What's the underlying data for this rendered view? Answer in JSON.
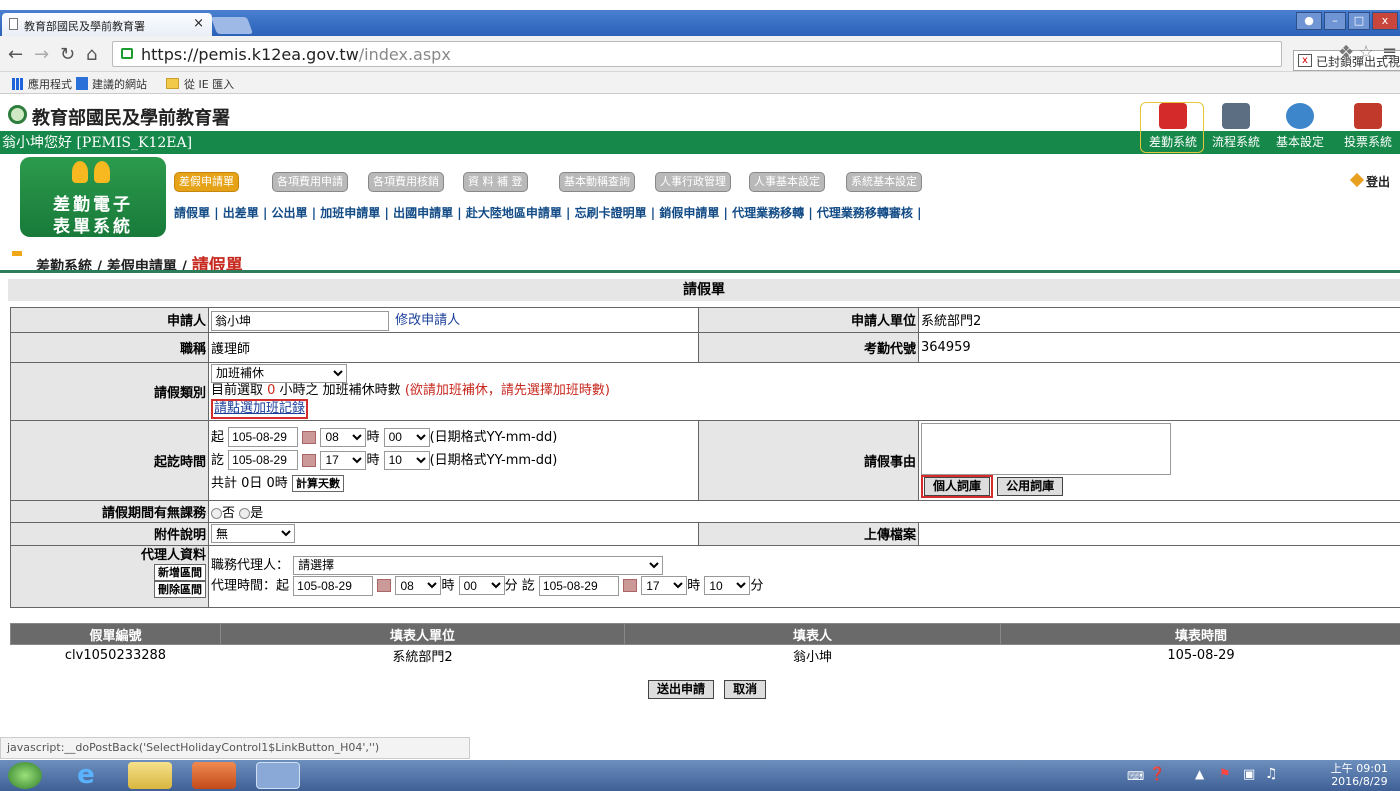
{
  "browser": {
    "tab_title": "教育部國民及學前教育署",
    "tab_close": "×",
    "url_host": "https://pemis.k12ea.gov.tw",
    "url_path": "/index.aspx",
    "blocked_popup": "已封鎖彈出式視窗",
    "bookmarks": [
      "應用程式",
      "建議的網站",
      "從 IE 匯入"
    ]
  },
  "site": {
    "title": "教育部國民及學前教育署",
    "user_greeting": "翁小坤您好 [PEMIS_K12EA]",
    "systems": [
      "差勤系統",
      "流程系統",
      "基本設定",
      "投票系統"
    ],
    "app_name_line1": "差勤電子",
    "app_name_line2": "表單系統",
    "logout": "登出"
  },
  "nav": {
    "tabs": [
      "差假申請單",
      "各項費用申請",
      "各項費用核銷",
      "資 料 補 登",
      "基本動稱查詢",
      "人事行政管理",
      "人事基本設定",
      "系統基本設定"
    ],
    "sublinks": [
      "請假單",
      "出差單",
      "公出單",
      "加班申請單",
      "出國申請單",
      "赴大陸地區申請單",
      "忘刷卡證明單",
      "銷假申請單",
      "代理業務移轉",
      "代理業務移轉審核"
    ]
  },
  "breadcrumb": {
    "root": "差勤系統",
    "mid": "差假申請單",
    "current": "請假單"
  },
  "form": {
    "title": "請假單",
    "applicant_label": "申請人",
    "applicant_value": "翁小坤",
    "modify_applicant": "修改申請人",
    "unit_label": "申請人單位",
    "unit_value": "系統部門2",
    "job_label": "職稱",
    "job_value": "護理師",
    "attend_code_label": "考勤代號",
    "attend_code_value": "364959",
    "leave_type_label": "請假類別",
    "leave_type_value": "加班補休",
    "leave_selected_text": "目前選取 ",
    "leave_selected_hours": "0",
    "leave_selected_suffix": " 小時之 加班補休時數",
    "leave_hint": "(欲請加班補休，請先選擇加班時數)",
    "overtime_link": "請點選加班記錄",
    "period_label": "起訖時間",
    "start_prefix": "起",
    "end_prefix": "訖",
    "start_date": "105-08-29",
    "start_hour": "08",
    "start_min": "00",
    "end_date": "105-08-29",
    "end_hour": "17",
    "end_min": "10",
    "hour_unit": "時",
    "date_format_hint": "(日期格式YY-mm-dd)",
    "total_text": "共計  0日  0時",
    "calc_days_btn": "計算天數",
    "reason_label": "請假事由",
    "personal_phrases_btn": "個人詞庫",
    "public_phrases_btn": "公用詞庫",
    "class_duty_label": "請假期間有無課務",
    "radio_no": "否",
    "radio_yes": "是",
    "attach_label": "附件說明",
    "attach_value": "無",
    "upload_label": "上傳檔案",
    "agent_label": "代理人資料",
    "add_section_btn": "新增區間",
    "delete_section_btn": "刪除區間",
    "agent_duty_label": "職務代理人：",
    "agent_select_value": "請選擇",
    "agent_time_label": "代理時間：起",
    "agent_start_date": "105-08-29",
    "agent_start_hour": "08",
    "agent_start_min": "00",
    "agent_end_prefix": "訖",
    "agent_end_date": "105-08-29",
    "agent_end_hour": "17",
    "agent_end_min": "10",
    "min_unit": "分"
  },
  "list": {
    "headers": [
      "假單編號",
      "填表人單位",
      "填表人",
      "填表時間"
    ],
    "rows": [
      [
        "clv1050233288",
        "系統部門2",
        "翁小坤",
        "105-08-29"
      ]
    ]
  },
  "actions": {
    "submit": "送出申請",
    "cancel": "取消"
  },
  "statusbar": "javascript:__doPostBack('SelectHolidayControl1$LinkButton_H04','')",
  "taskbar": {
    "time": "上午 09:01",
    "date": "2016/8/29"
  }
}
